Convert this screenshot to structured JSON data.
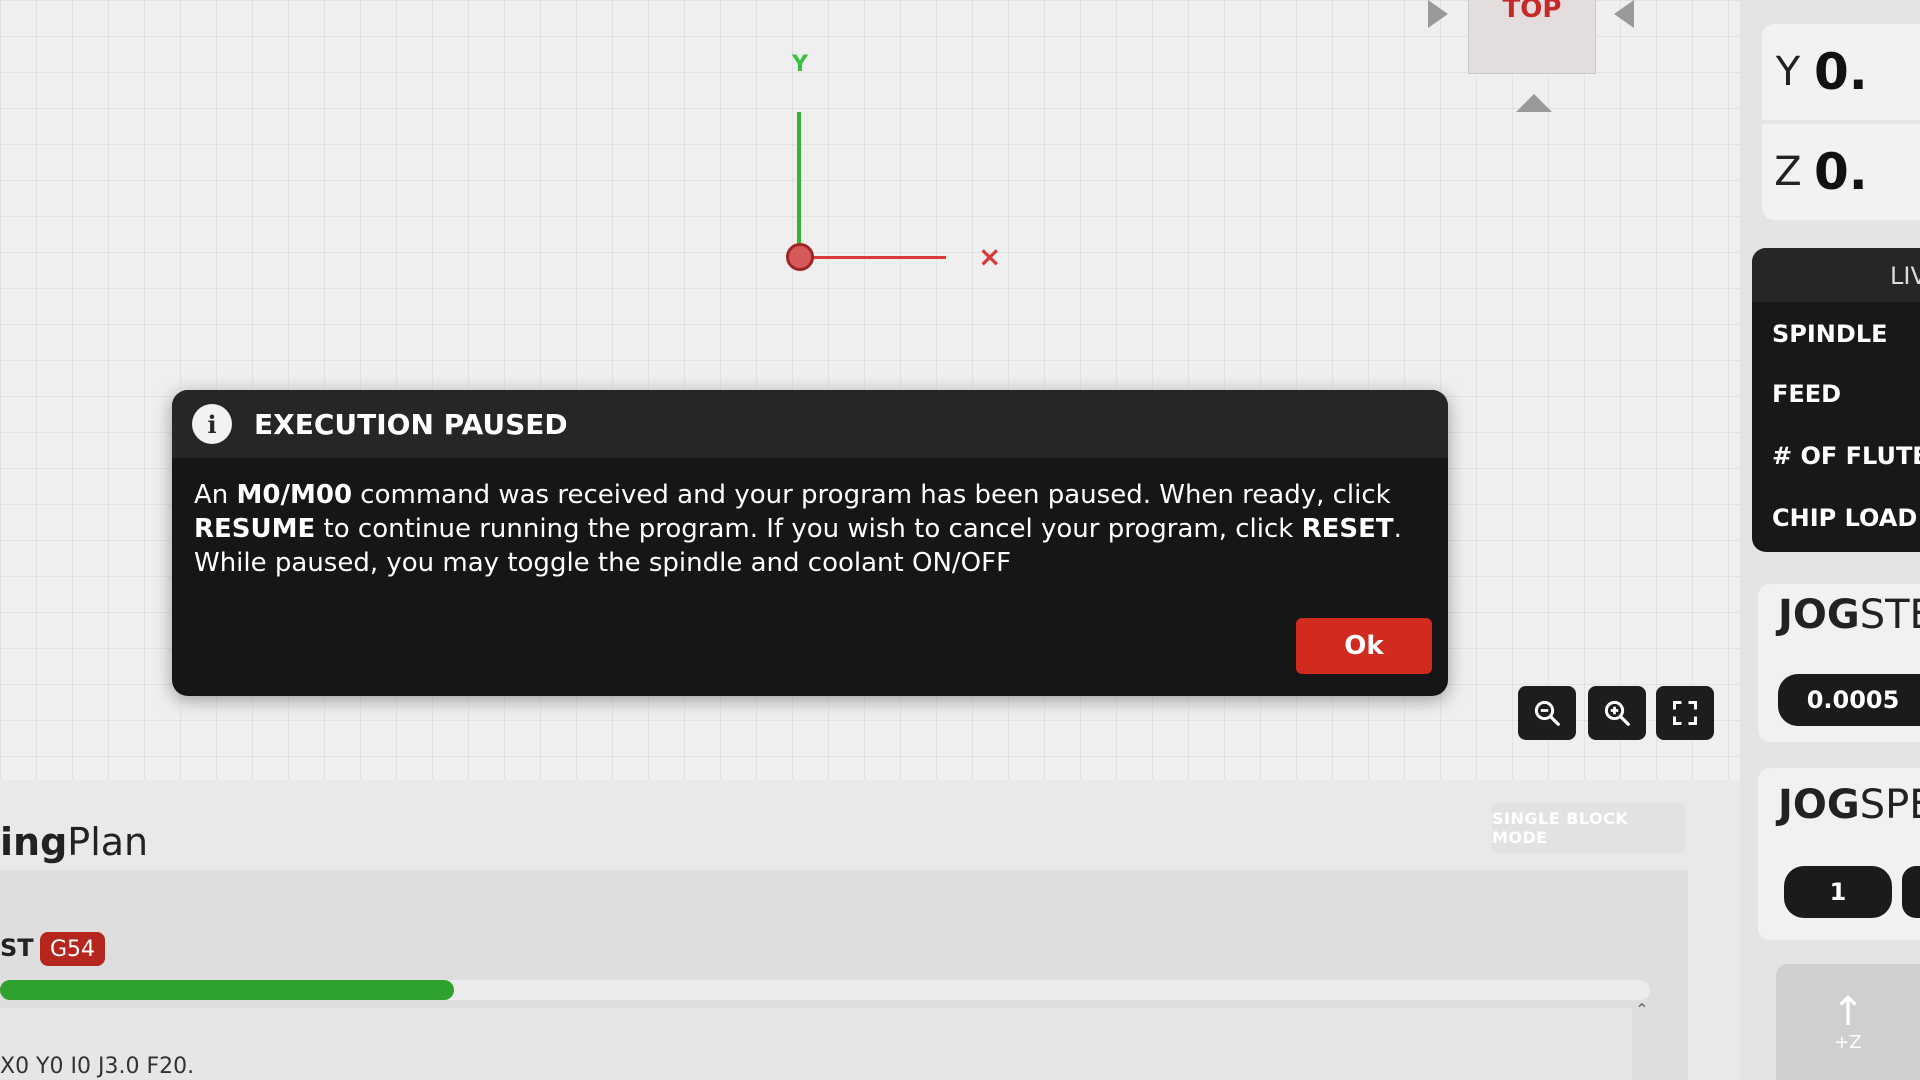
{
  "viewport": {
    "axis_y_label": "Y",
    "axis_x_label": "×",
    "view_label": "TOP"
  },
  "modal": {
    "title": "EXECUTION PAUSED",
    "body": {
      "p1": "An ",
      "b1": "M0/M00",
      "p2": " command was received and your program has been paused. When ready, click ",
      "b2": "RESUME",
      "p3": " to continue running the program. If you wish to cancel your program, click ",
      "b3": "RESET",
      "p4": ". While paused, you may toggle the spindle and coolant ON/OFF"
    },
    "ok_label": "Ok"
  },
  "plan": {
    "title_bold": "ing",
    "title_rest": "Plan",
    "single_block_label": "SINGLE BLOCK MODE",
    "status": "ST",
    "wcs": "G54",
    "progress": 0.275,
    "gcode_line": "X0 Y0 I0 J3.0 F20."
  },
  "dro": {
    "y_axis": "Y",
    "y_value": "0.",
    "z_axis": "Z",
    "z_value": "0."
  },
  "live": {
    "header": "LIV",
    "spindle": "SPINDLE",
    "feed": "FEED",
    "flutes": "# OF FLUTES",
    "chip_load": "CHIP LOAD"
  },
  "jog": {
    "step_title_bold": "JOG",
    "step_title_rest": "STE",
    "step_value": "0.0005",
    "speed_title_bold": "JOG",
    "speed_title_rest": "SPE",
    "speed_value": "1",
    "z_label": "+Z"
  },
  "colors": {
    "accent_red": "#d12a1e",
    "progress_green": "#2ea12e",
    "axis_y": "#2fb52f",
    "axis_x": "#d83a3a"
  },
  "icons": [
    "info-icon",
    "zoom-out-icon",
    "zoom-in-icon",
    "fullscreen-icon",
    "arrow-up-icon"
  ]
}
